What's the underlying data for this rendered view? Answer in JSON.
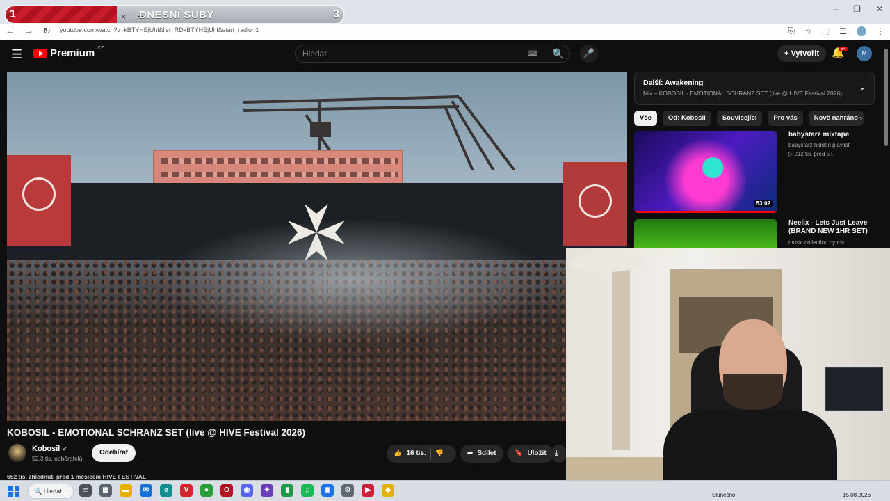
{
  "browser": {
    "goal": {
      "left_number": "1",
      "title": "DNESNÍ SUBY",
      "right_number": "3",
      "progress": 0.33
    },
    "tab_close": "×",
    "new_tab": "+",
    "window_controls": [
      "–",
      "❐",
      "✕"
    ],
    "nav": {
      "back": "←",
      "forward": "→",
      "reload": "↻"
    },
    "url": "youtube.com/watch?v=kBTYHEjUhl&list=RDkBTYHEjUhl&start_radio=1",
    "addr_icons": [
      "⎘",
      "☆",
      "⬚",
      "☰",
      "⋮"
    ]
  },
  "youtube_header": {
    "menu": "☰",
    "logo_text": "Premium",
    "logo_country": "CZ",
    "search_placeholder": "Hledat",
    "keyboard_icon": "⌨",
    "search_icon": "🔍",
    "mic_icon": "🎤",
    "create_label": "+ Vytvořit",
    "bell_icon": "🔔",
    "notifications_badge": "9+",
    "avatar_initial": "M"
  },
  "video": {
    "title": "KOBOSIL - EMOTIONAL SCHRANZ SET (live @ HIVE Festival 2026)",
    "channel": "Kobosil",
    "verified": "✔",
    "subscribers": "52,3 tis. odběratelů",
    "subscribe_label": "Odebírat",
    "likes": "16 tis.",
    "share_label": "Sdílet",
    "save_label": "Uložit",
    "like_icon": "👍",
    "dislike_icon": "👎",
    "share_icon": "➦",
    "save_icon": "🔖",
    "download_icon": "⤓",
    "description_snippet": "652 tis. zhlédnutí  před 1 měsícem  HIVE FESTIVAL"
  },
  "sidebar": {
    "playlist": {
      "title": "Další: Awakening",
      "subtitle": "Mix – KOBOSIL - EMOTIONAL SCHRANZ SET (live @ HIVE Festival 2026)",
      "chevron": "⌄"
    },
    "chips": [
      {
        "label": "Vše",
        "active": true
      },
      {
        "label": "Od: Kobosil",
        "active": false
      },
      {
        "label": "Související",
        "active": false
      },
      {
        "label": "Pro vás",
        "active": false
      },
      {
        "label": "Nově nahráno",
        "active": false
      }
    ],
    "chips_next": "›",
    "recommendations": [
      {
        "title": "babystarz mixtape",
        "channel": "babystarz hidden playlist",
        "meta": "▷ 212 tis.  před 5 l.",
        "duration": "53:02"
      },
      {
        "title": "Neelix - Lets Just Leave (BRAND NEW 1HR SET)",
        "channel": "music collection by ms",
        "meta": "",
        "duration": ""
      }
    ]
  },
  "taskbar": {
    "search_label": "Hledat",
    "apps": [
      {
        "name": "taskview",
        "glyph": "▭",
        "color": "#4a4f57"
      },
      {
        "name": "widgets",
        "glyph": "▦",
        "color": "#5b6470"
      },
      {
        "name": "explorer",
        "glyph": "▬",
        "color": "#e6b000"
      },
      {
        "name": "mail",
        "glyph": "✉",
        "color": "#1570d8"
      },
      {
        "name": "edge",
        "glyph": "e",
        "color": "#0f8f8f"
      },
      {
        "name": "vivaldi",
        "glyph": "V",
        "color": "#d3242c"
      },
      {
        "name": "chrome",
        "glyph": "●",
        "color": "#2a9d3a"
      },
      {
        "name": "opera",
        "glyph": "O",
        "color": "#b3121f"
      },
      {
        "name": "discord",
        "glyph": "◉",
        "color": "#5865f2"
      },
      {
        "name": "app-star",
        "glyph": "✦",
        "color": "#6a3fb5"
      },
      {
        "name": "app-green",
        "glyph": "▮",
        "color": "#1e9a4a"
      },
      {
        "name": "spotify",
        "glyph": "♫",
        "color": "#1db954"
      },
      {
        "name": "app-window",
        "glyph": "▣",
        "color": "#1a73e8"
      },
      {
        "name": "settings",
        "glyph": "⚙",
        "color": "#5f6873"
      },
      {
        "name": "app-red",
        "glyph": "▶",
        "color": "#cc1f3a"
      },
      {
        "name": "app-yellow",
        "glyph": "◆",
        "color": "#e2b100"
      }
    ],
    "weather": "Slunečno",
    "date": "15.08.2026"
  }
}
